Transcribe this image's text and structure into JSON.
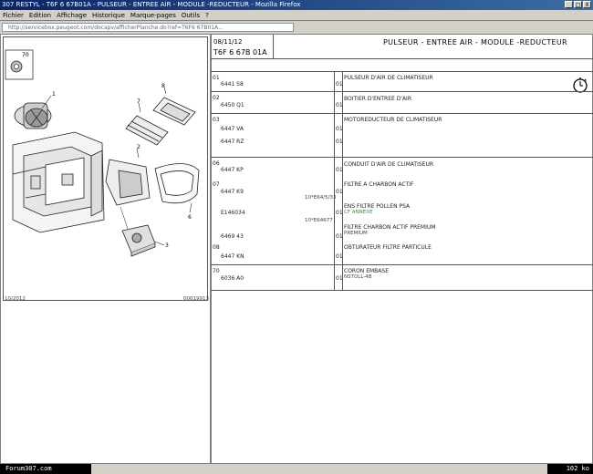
{
  "window": {
    "title": "307 RESTYL - T6F 6 67B01A - PULSEUR - ENTREE AIR - MODULE -REDUCTEUR - Mozilla Firefox",
    "controls": [
      "_",
      "□",
      "X"
    ]
  },
  "menu": [
    "Fichier",
    "Edition",
    "Affichage",
    "Historique",
    "Marque-pages",
    "Outils",
    "?"
  ],
  "address": {
    "value": "http://servicebox.peugeot.com/docapv/afficherPlanche.do?ref=T6F6 67B01A..."
  },
  "left_panel": {
    "box_label": "70",
    "callouts": [
      "1",
      "2",
      "3",
      "6",
      "7",
      "8"
    ],
    "footer_left": "10/2012",
    "footer_right": "00019913"
  },
  "header": {
    "date": "08/11/12",
    "ref": "T6F 6 67B 01A",
    "title": "PULSEUR - ENTREE AIR - MODULE -REDUCTEUR"
  },
  "parts": [
    {
      "num": "01",
      "code": "6441 S8",
      "qty": "01",
      "desc": "PULSEUR D'AIR DE CLIMATISEUR"
    },
    {
      "num": "02",
      "code": "6450 Q1",
      "qty": "01",
      "desc": "BOITIER D'ENTREE D'AIR"
    },
    {
      "num": "03",
      "code": "6447 VA",
      "qty": "01",
      "desc": "MOTOREDUCTEUR DE CLIMATISEUR"
    },
    {
      "num": "",
      "code": "6447 RZ",
      "qty": "01",
      "desc": ""
    },
    {
      "num": "06",
      "code": "6447 KP",
      "qty": "01",
      "desc": "CONDUIT D'AIR DE CLIMATISEUR"
    },
    {
      "num": "07",
      "code": "6447 K9",
      "qty": "01",
      "desc": "FILTRE A CHARBON ACTIF"
    },
    {
      "num": "",
      "code": "",
      "qty": "",
      "desc": "",
      "extra": "10*E64/5/33"
    },
    {
      "num": "",
      "code": "E146034",
      "qty": "01",
      "desc": "ENS FILTRE POLLEN PSA",
      "note": "CF ANNEXE"
    },
    {
      "num": "",
      "code": "",
      "qty": "",
      "desc": "",
      "extra": "10*E64677"
    },
    {
      "num": "",
      "code": "",
      "qty": "",
      "desc": "FILTRE CHARBON ACTIF PREMIUM",
      "note": "PREMIUM"
    },
    {
      "num": "",
      "code": "6469 43",
      "qty": "01",
      "desc": ""
    },
    {
      "num": "08",
      "code": "6447 KN",
      "qty": "01",
      "desc": "OBTURATEUR FILTRE PARTICULE"
    },
    {
      "num": "70",
      "code": "6036 A0",
      "qty": "01",
      "desc": "CORON EMBASE",
      "note": "NSTOLL-4B"
    }
  ],
  "statusbar": {
    "left": "Forum307.com",
    "right": "102 ko"
  }
}
